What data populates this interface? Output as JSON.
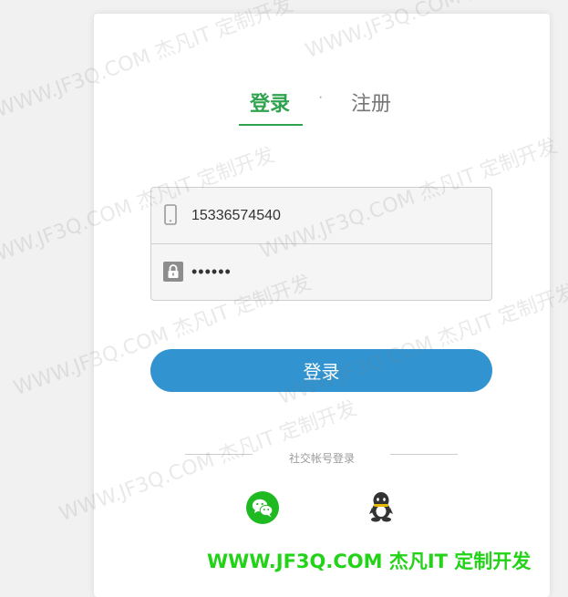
{
  "tabs": {
    "login": "登录",
    "separator": "·",
    "register": "注册"
  },
  "form": {
    "phone_value": "15336574540",
    "password_value": "••••••"
  },
  "login_button": "登录",
  "social": {
    "title": "社交帐号登录",
    "wechat_icon": "wechat-icon",
    "qq_icon": "qq-icon"
  },
  "colors": {
    "accent_green": "#2fa34e",
    "button_blue": "#3194d0",
    "wechat_green": "#1fb922"
  },
  "watermark": {
    "text": "WWW.JF3Q.COM 杰凡IT  定制开发",
    "footer": "WWW.JF3Q.COM 杰凡IT  定制开发"
  }
}
